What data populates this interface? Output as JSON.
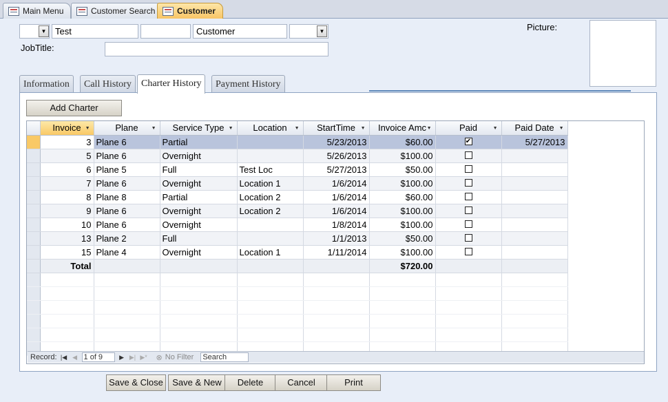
{
  "doc_tabs": [
    {
      "label": "Main Menu",
      "active": false
    },
    {
      "label": "Customer Search",
      "active": false
    },
    {
      "label": "Customer",
      "active": true
    }
  ],
  "header": {
    "title_value": "",
    "first_name": "Test",
    "middle_name": "",
    "last_name": "Customer",
    "suffix_value": "",
    "jobtitle_label": "JobTitle:",
    "jobtitle_value": "",
    "picture_label": "Picture:"
  },
  "tabs": [
    "Information",
    "Call History",
    "Charter History",
    "Payment History"
  ],
  "active_tab": "Charter History",
  "add_charter_label": "Add Charter",
  "datasheet": {
    "columns": [
      "Invoice",
      "Plane",
      "Service Type",
      "Location",
      "StartTime",
      "Invoice Amc",
      "Paid",
      "Paid Date"
    ],
    "rows": [
      {
        "invoice": "3",
        "plane": "Plane 6",
        "service": "Partial",
        "location": "",
        "start": "5/23/2013",
        "amount": "$60.00",
        "paid": true,
        "paid_date": "5/27/2013"
      },
      {
        "invoice": "5",
        "plane": "Plane 6",
        "service": "Overnight",
        "location": "",
        "start": "5/26/2013",
        "amount": "$100.00",
        "paid": false,
        "paid_date": ""
      },
      {
        "invoice": "6",
        "plane": "Plane 5",
        "service": "Full",
        "location": "Test Loc",
        "start": "5/27/2013",
        "amount": "$50.00",
        "paid": false,
        "paid_date": ""
      },
      {
        "invoice": "7",
        "plane": "Plane 6",
        "service": "Overnight",
        "location": "Location 1",
        "start": "1/6/2014",
        "amount": "$100.00",
        "paid": false,
        "paid_date": ""
      },
      {
        "invoice": "8",
        "plane": "Plane 8",
        "service": "Partial",
        "location": "Location 2",
        "start": "1/6/2014",
        "amount": "$60.00",
        "paid": false,
        "paid_date": ""
      },
      {
        "invoice": "9",
        "plane": "Plane 6",
        "service": "Overnight",
        "location": "Location 2",
        "start": "1/6/2014",
        "amount": "$100.00",
        "paid": false,
        "paid_date": ""
      },
      {
        "invoice": "10",
        "plane": "Plane 6",
        "service": "Overnight",
        "location": "",
        "start": "1/8/2014",
        "amount": "$100.00",
        "paid": false,
        "paid_date": ""
      },
      {
        "invoice": "13",
        "plane": "Plane 2",
        "service": "Full",
        "location": "",
        "start": "1/1/2013",
        "amount": "$50.00",
        "paid": false,
        "paid_date": ""
      },
      {
        "invoice": "15",
        "plane": "Plane 4",
        "service": "Overnight",
        "location": "Location 1",
        "start": "1/11/2014",
        "amount": "$100.00",
        "paid": false,
        "paid_date": ""
      }
    ],
    "total_label": "Total",
    "total_amount": "$720.00"
  },
  "navigation": {
    "record_label": "Record:",
    "position": "1 of 9",
    "filter_label": "No Filter",
    "search_placeholder": "Search"
  },
  "buttons": {
    "save_close": "Save & Close",
    "save_new": "Save & New",
    "delete": "Delete",
    "cancel": "Cancel",
    "print": "Print"
  }
}
